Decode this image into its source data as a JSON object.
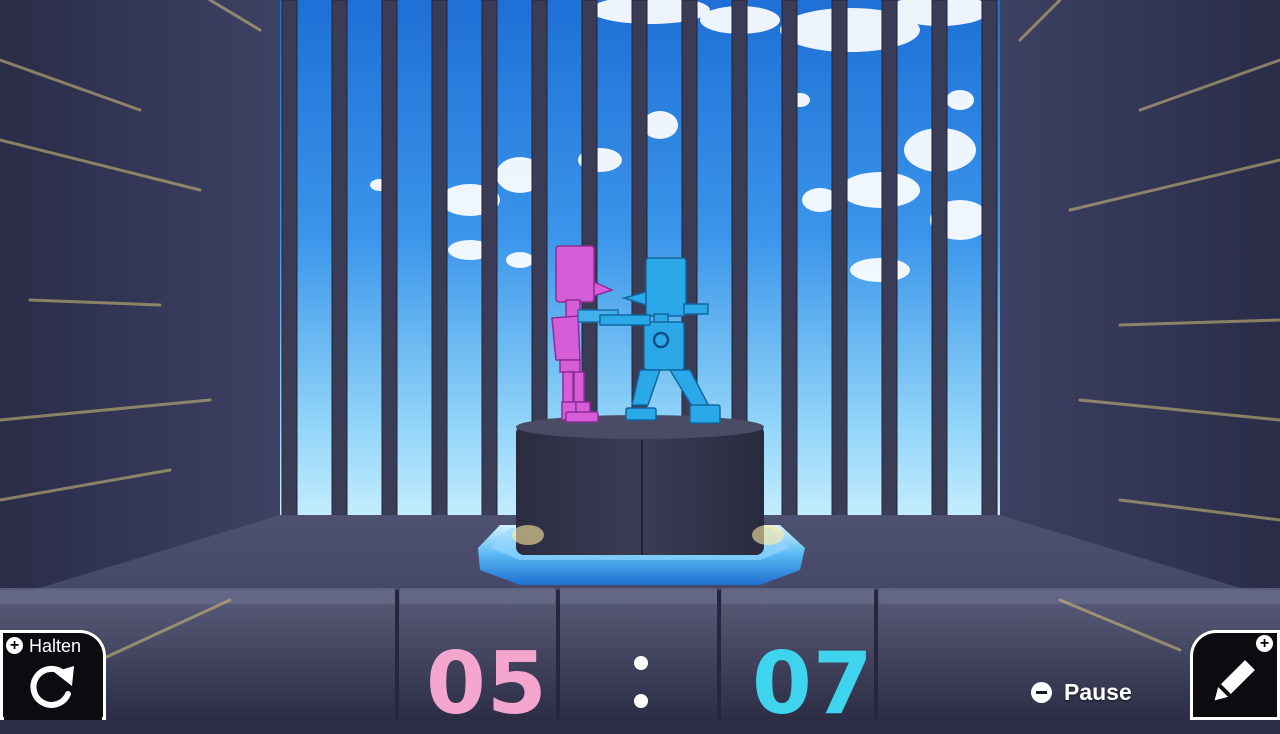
{
  "hud": {
    "hold_label": "Halten",
    "pause_label": "Pause",
    "score_left": "05",
    "score_right": "07",
    "score_left_color": "#f4a6cf",
    "score_right_color": "#3ed4ee"
  },
  "icons": {
    "hold": "refresh-icon",
    "edit": "pencil-icon",
    "plus": "plus-icon",
    "minus": "minus-icon"
  },
  "scene": {
    "figure_left_color": "#d65cd8",
    "figure_right_color": "#2aa8e8"
  }
}
